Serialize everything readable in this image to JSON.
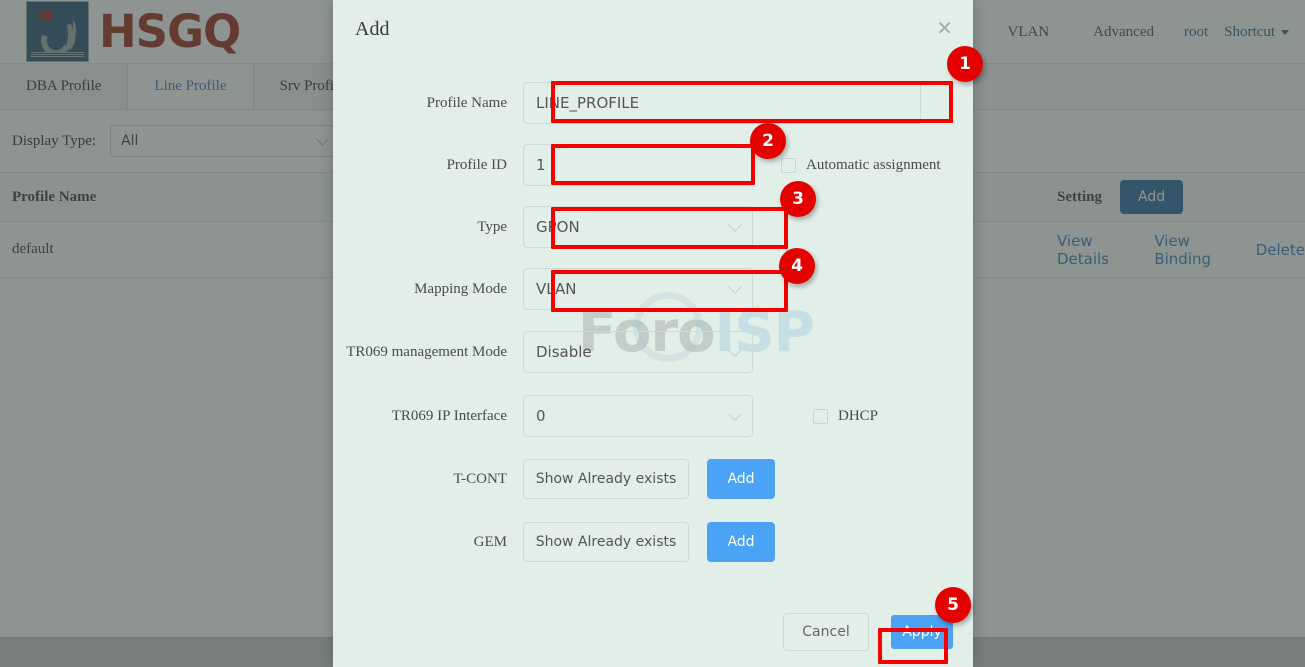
{
  "app": {
    "brand": "HSGQ",
    "logo_icon": "hsgq-logo-icon"
  },
  "topnav": {
    "items": [
      {
        "label": "VLAN",
        "style": "plain"
      },
      {
        "label": "Advanced",
        "style": "plain"
      },
      {
        "label": "root",
        "style": "link"
      },
      {
        "label": "Shortcut",
        "style": "link"
      }
    ]
  },
  "tabs": [
    {
      "label": "DBA Profile",
      "active": false
    },
    {
      "label": "Line Profile",
      "active": true
    },
    {
      "label": "Srv Profile",
      "active": false
    }
  ],
  "filter": {
    "label": "Display Type:",
    "value": "All",
    "chevron_icon": "chevron-down-icon"
  },
  "table": {
    "headers": {
      "name": "Profile Name",
      "setting": "Setting"
    },
    "add_button": "Add",
    "rows": [
      {
        "name": "default",
        "actions": [
          "View Details",
          "View Binding",
          "Delete"
        ]
      }
    ]
  },
  "watermark": {
    "part1": "Foro",
    "part2": "ISP"
  },
  "modal": {
    "title": "Add",
    "close_icon": "close-icon",
    "fields": {
      "profile_name": {
        "label": "Profile Name",
        "value": "LINE_PROFILE"
      },
      "profile_id": {
        "label": "Profile ID",
        "value": "1",
        "checkbox_label": "Automatic assignment",
        "checkbox_checked": false
      },
      "type": {
        "label": "Type",
        "value": "GPON"
      },
      "mapping_mode": {
        "label": "Mapping Mode",
        "value": "VLAN"
      },
      "tr069_management_mode": {
        "label": "TR069 management Mode",
        "value": "Disable"
      },
      "tr069_ip_interface": {
        "label": "TR069 IP Interface",
        "value": "0",
        "checkbox_label": "DHCP",
        "checkbox_checked": false
      },
      "tcont": {
        "label": "T-CONT",
        "show_button": "Show Already exists",
        "add_button": "Add"
      },
      "gem": {
        "label": "GEM",
        "show_button": "Show Already exists",
        "add_button": "Add"
      }
    },
    "footer": {
      "cancel": "Cancel",
      "apply": "Apply"
    }
  },
  "annotations": {
    "accent_color": "#e50000",
    "steps": [
      {
        "number": "1",
        "target": "profile-name-input"
      },
      {
        "number": "2",
        "target": "profile-id-input"
      },
      {
        "number": "3",
        "target": "type-select"
      },
      {
        "number": "4",
        "target": "mapping-mode-select"
      },
      {
        "number": "5",
        "target": "apply-button"
      }
    ]
  }
}
